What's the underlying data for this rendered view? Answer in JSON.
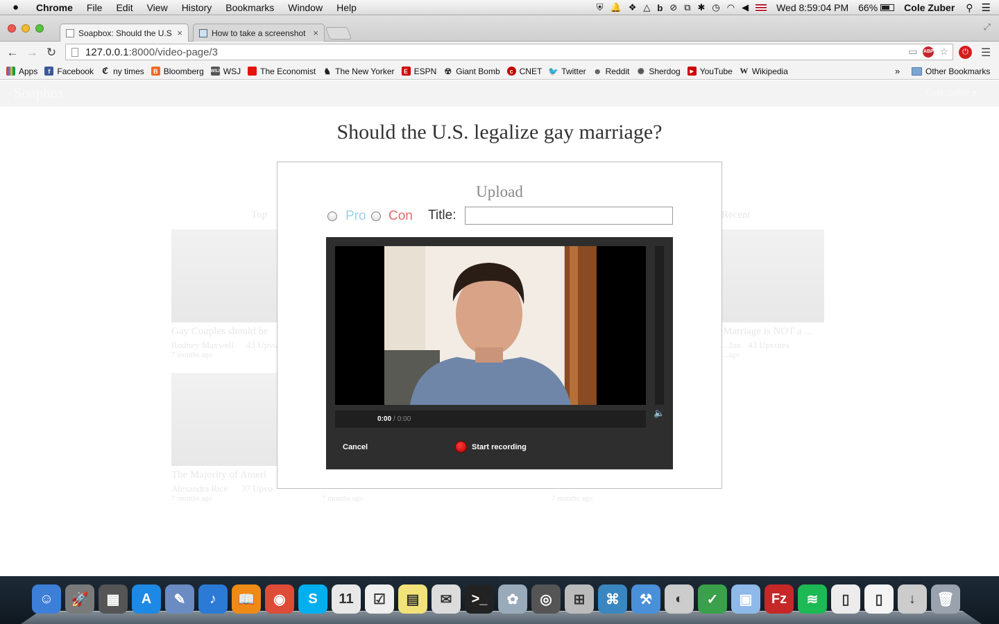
{
  "menubar": {
    "app_name": "Chrome",
    "menus": [
      "File",
      "Edit",
      "View",
      "History",
      "Bookmarks",
      "Window",
      "Help"
    ],
    "clock": "Wed 8:59:04 PM",
    "battery": "66%",
    "battery_level": 0.66,
    "user": "Cole Zuber"
  },
  "tabs": [
    {
      "title": "Soapbox: Should the U.S. le",
      "active": true
    },
    {
      "title": "How to take a screenshot",
      "active": false
    }
  ],
  "omnibox": {
    "host": "127.0.0.1",
    "path": ":8000/video-page/3"
  },
  "bookmarks": {
    "items": [
      {
        "label": "Apps",
        "icon": "apps-grid-icon",
        "color": "#e0442a"
      },
      {
        "label": "Facebook",
        "icon": "facebook-icon",
        "color": "#3b5998"
      },
      {
        "label": "ny times",
        "icon": "nytimes-icon",
        "color": "#111111"
      },
      {
        "label": "Bloomberg",
        "icon": "bloomberg-icon",
        "color": "#f26722"
      },
      {
        "label": "WSJ",
        "icon": "wsj-icon",
        "color": "#555555"
      },
      {
        "label": "The Economist",
        "icon": "economist-icon",
        "color": "#e3120b"
      },
      {
        "label": "The New Yorker",
        "icon": "newyorker-icon",
        "color": "#222222"
      },
      {
        "label": "ESPN",
        "icon": "espn-icon",
        "color": "#cc0000"
      },
      {
        "label": "Giant Bomb",
        "icon": "giantbomb-icon",
        "color": "#333333"
      },
      {
        "label": "CNET",
        "icon": "cnet-icon",
        "color": "#c00000"
      },
      {
        "label": "Twitter",
        "icon": "twitter-icon",
        "color": "#1da1f2"
      },
      {
        "label": "Reddit",
        "icon": "reddit-icon",
        "color": "#555555"
      },
      {
        "label": "Sherdog",
        "icon": "sherdog-icon",
        "color": "#555555"
      },
      {
        "label": "YouTube",
        "icon": "youtube-icon",
        "color": "#cc0000"
      },
      {
        "label": "Wikipedia",
        "icon": "wikipedia-icon",
        "color": "#333333"
      }
    ],
    "overflow": "»",
    "other": "Other Bookmarks"
  },
  "site": {
    "brand": "Soapbox",
    "user_menu": "Cole Zuber",
    "question": "Should the U.S. legalize gay marriage?"
  },
  "background": {
    "section_left": "Top",
    "section_right": "Recent",
    "videos": [
      {
        "title": "Gay Couples should be",
        "author": "Rodney Maxwell",
        "upvotes": "43 Upvo",
        "time": "7 months ago"
      },
      {
        "title": "Marriage is NOT a ...",
        "author": "...lan",
        "upvotes": "43 Upvotes",
        "time": "...ago"
      },
      {
        "title": "The Majority of Ameri",
        "author": "Alexandra Rice",
        "upvotes": "37 Upvo",
        "time": "7 months ago"
      },
      {
        "title": "",
        "author": "",
        "upvotes": "",
        "time": "7 months ago"
      },
      {
        "title": "",
        "author": "",
        "upvotes": "",
        "time": "7 months ago"
      }
    ]
  },
  "modal": {
    "title": "Upload",
    "pro_label": "Pro",
    "con_label": "Con",
    "title_label": "Title:",
    "title_value": "",
    "pro_color": "#9fd0e6",
    "con_color": "#e46a6a",
    "recorder": {
      "time_current": "0:00",
      "time_separator": "/",
      "time_total": "0:00",
      "cancel": "Cancel",
      "record": "Start recording"
    }
  },
  "dock": {
    "apps": [
      {
        "name": "finder-icon",
        "glyph": "☺",
        "color": "#3d7fd8"
      },
      {
        "name": "launchpad-icon",
        "glyph": "🚀",
        "color": "#7a7a7a"
      },
      {
        "name": "mission-control-icon",
        "glyph": "▦",
        "color": "#555"
      },
      {
        "name": "app-store-icon",
        "glyph": "A",
        "color": "#1e88e5"
      },
      {
        "name": "preview-icon",
        "glyph": "✎",
        "color": "#6b8cc2"
      },
      {
        "name": "itunes-icon",
        "glyph": "♪",
        "color": "#2a7ad6"
      },
      {
        "name": "ibooks-icon",
        "glyph": "📖",
        "color": "#f08a16"
      },
      {
        "name": "chrome-icon",
        "glyph": "◉",
        "color": "#dd4b39"
      },
      {
        "name": "skype-icon",
        "glyph": "S",
        "color": "#00aff0"
      },
      {
        "name": "calendar-icon",
        "glyph": "11",
        "color": "#e8e8e8"
      },
      {
        "name": "reminders-icon",
        "glyph": "☑",
        "color": "#efefef"
      },
      {
        "name": "stickies-icon",
        "glyph": "▤",
        "color": "#f2e27a"
      },
      {
        "name": "textedit-icon",
        "glyph": "✉",
        "color": "#dcdcdc"
      },
      {
        "name": "terminal-icon",
        "glyph": ">_",
        "color": "#222"
      },
      {
        "name": "photos-icon",
        "glyph": "✿",
        "color": "#9ab"
      },
      {
        "name": "facetime-icon",
        "glyph": "◎",
        "color": "#555"
      },
      {
        "name": "calculator-icon",
        "glyph": "⊞",
        "color": "#bbb"
      },
      {
        "name": "mysql-workbench-icon",
        "glyph": "⌘",
        "color": "#3a86c0"
      },
      {
        "name": "xcode-icon",
        "glyph": "⚒",
        "color": "#4a90d9"
      },
      {
        "name": "sequel-icon",
        "glyph": "◐",
        "color": "#ccc"
      },
      {
        "name": "coda-icon",
        "glyph": "✓",
        "color": "#3aa04a"
      },
      {
        "name": "virtualbox-icon",
        "glyph": "▣",
        "color": "#8fb9e8"
      },
      {
        "name": "filezilla-icon",
        "glyph": "Fz",
        "color": "#c62828"
      },
      {
        "name": "spotify-icon",
        "glyph": "≋",
        "color": "#1db954"
      },
      {
        "name": "document-icon",
        "glyph": "▯",
        "color": "#ececec"
      },
      {
        "name": "document2-icon",
        "glyph": "▯",
        "color": "#f4f4f4"
      },
      {
        "name": "downloads-icon",
        "glyph": "↓",
        "color": "#ccc"
      },
      {
        "name": "trash-icon",
        "glyph": "🗑",
        "color": "#9aa3ad"
      }
    ]
  }
}
